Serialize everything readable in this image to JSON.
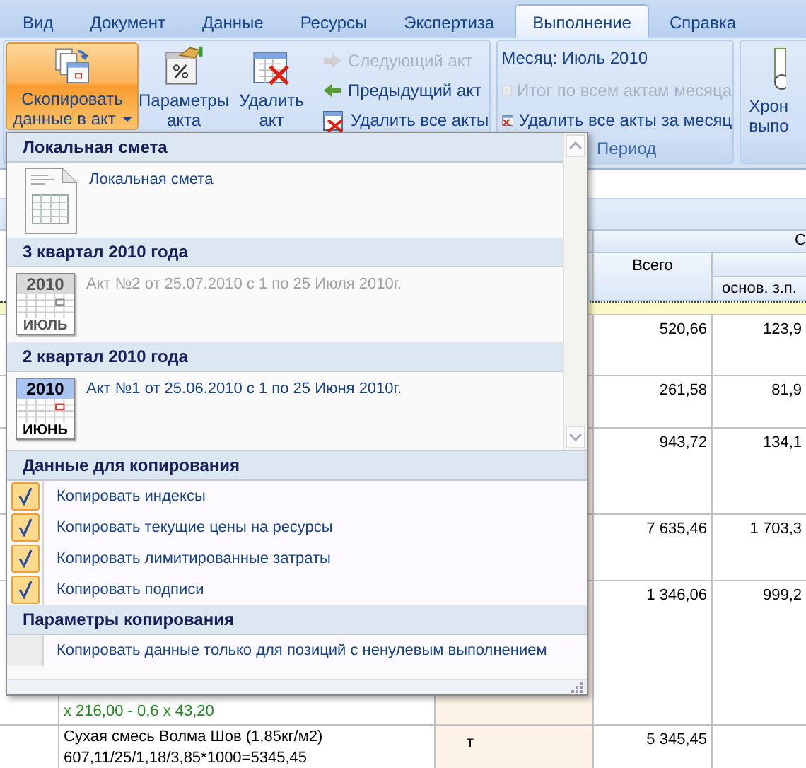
{
  "ribbon": {
    "tabs": [
      {
        "label": "Вид",
        "selected": false
      },
      {
        "label": "Документ",
        "selected": false
      },
      {
        "label": "Данные",
        "selected": false
      },
      {
        "label": "Ресурсы",
        "selected": false
      },
      {
        "label": "Экспертиза",
        "selected": false
      },
      {
        "label": "Выполнение",
        "selected": true
      },
      {
        "label": "Справка",
        "selected": false
      }
    ],
    "large_buttons": [
      {
        "label": "Скопировать данные в акт",
        "kind": "copy",
        "has_dropdown": true,
        "pressed": true
      },
      {
        "label": "Параметры акта",
        "kind": "params",
        "has_dropdown": false,
        "pressed": false
      },
      {
        "label": "Удалить акт",
        "kind": "delete",
        "has_dropdown": false,
        "pressed": false
      }
    ],
    "small_buttons": [
      {
        "label": "Следующий акт",
        "kind": "next",
        "disabled": true
      },
      {
        "label": "Предыдущий акт",
        "kind": "prev",
        "disabled": false
      },
      {
        "label": "Удалить все акты",
        "kind": "delete-all",
        "disabled": false
      }
    ],
    "period_group": {
      "month_label": "Месяц: Июль 2010",
      "group_label": "Период",
      "buttons": [
        {
          "label": "Итог по всем актам месяца",
          "kind": "sum",
          "disabled": true
        },
        {
          "label": "Удалить все акты за месяц",
          "kind": "delete-month",
          "disabled": false
        }
      ]
    },
    "cut_button": {
      "label": "Хрон выпо"
    }
  },
  "sheet": {
    "group_header": "С",
    "total_header": "Всего",
    "sub_header": "основ. з.п.",
    "rows": [
      {
        "total": "520,66",
        "base": "123,9"
      },
      {
        "total": "261,58",
        "base": "81,9"
      },
      {
        "total": "943,72",
        "base": "134,1"
      },
      {
        "total": "7 635,46",
        "base": "1 703,3"
      },
      {
        "total": "1 346,06",
        "base": "999,2",
        "formula_lines": [
          "x 216,00 - 0,6 x 43,20"
        ]
      },
      {
        "name_lines": [
          "Сухая смесь Волма Шов (1,85кг/м2)",
          "607,11/25/1,18/3,85*1000=5345,45"
        ],
        "unit": "т",
        "total": "5 345,45"
      }
    ]
  },
  "dropdown": {
    "sources": [
      {
        "heading": "Локальная смета",
        "items": [
          {
            "kind": "document",
            "label": "Локальная смета",
            "disabled": false
          }
        ]
      },
      {
        "heading": "3 квартал 2010 года",
        "items": [
          {
            "kind": "calendar",
            "year": "2010",
            "month": "ИЮЛЬ",
            "label": "Акт №2 от 25.07.2010 с 1 по 25 Июля 2010г.",
            "disabled": true
          }
        ]
      },
      {
        "heading": "2 квартал 2010 года",
        "items": [
          {
            "kind": "calendar",
            "year": "2010",
            "month": "ИЮНЬ",
            "label": "Акт №1 от 25.06.2010 с 1 по 25 Июня 2010г.",
            "disabled": false
          }
        ]
      }
    ],
    "option_groups": [
      {
        "heading": "Данные для копирования",
        "options": [
          {
            "label": "Копировать индексы",
            "checked": true
          },
          {
            "label": "Копировать текущие цены на ресурсы",
            "checked": true
          },
          {
            "label": "Копировать лимитированные затраты",
            "checked": true
          },
          {
            "label": "Копировать подписи",
            "checked": true
          }
        ]
      },
      {
        "heading": "Параметры копирования",
        "options": [
          {
            "label": "Копировать данные только для позиций с ненулевым выполнением",
            "checked": false
          }
        ]
      }
    ]
  }
}
